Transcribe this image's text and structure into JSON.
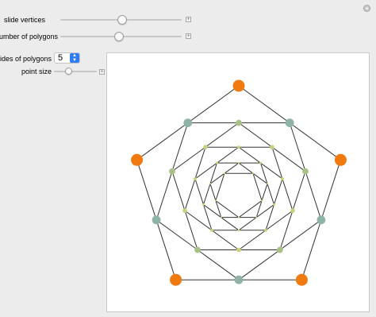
{
  "controls": {
    "slide_vertices": {
      "label": "slide vertices",
      "value": 0.5
    },
    "number_of_polygons": {
      "label": "number of polygons",
      "value": 0.47
    },
    "sides_of_polygons": {
      "label": "sides of polygons",
      "value": "5"
    },
    "point_size": {
      "label": "point size",
      "value": 0.22
    }
  },
  "icons": {
    "corner": "gear-icon",
    "plus": "plus-icon",
    "arrows": "up-down-arrows-icon"
  },
  "plot": {
    "sides": 5,
    "polygon_count": 8,
    "colors": {
      "line": "#333333",
      "outer_vertex": "#f07a10",
      "mid_outer": "#8fb3a6",
      "mid_inner": "#a7c187",
      "inner": "#c9d27a"
    }
  }
}
